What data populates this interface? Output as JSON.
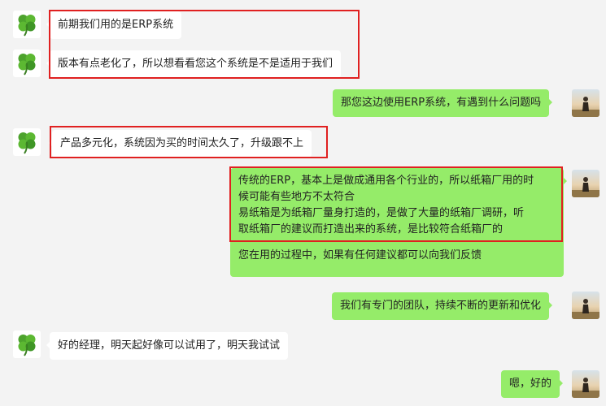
{
  "messages": {
    "m1": "前期我们用的是ERP系统",
    "m2": "版本有点老化了，所以想看看您这个系统是不是适用于我们",
    "m3": "那您这边使用ERP系统，有遇到什么问题吗",
    "m4": "产品多元化，系统因为买的时间太久了，升级跟不上",
    "m5": {
      "line1": "传统的ERP，基本上是做成通用各个行业的，所以纸箱厂用的时",
      "line2": "候可能有些地方不太符合",
      "line3": "易纸箱是为纸箱厂量身打造的，是做了大量的纸箱厂调研，听",
      "line4": "取纸箱厂的建议而打造出来的系统，是比较符合纸箱厂的",
      "line5": "您在用的过程中，如果有任何建议都可以向我们反馈"
    },
    "m6": "我们有专门的团队，持续不断的更新和优化",
    "m7": "好的经理，明天起好像可以试用了，明天我试试",
    "m8": "嗯，好的"
  },
  "colors": {
    "chat_background": "#f3f3f3",
    "incoming_bubble": "#ffffff",
    "outgoing_bubble": "#95ec69",
    "highlight_border": "#e02020"
  },
  "icons": {
    "contact_avatar": "four-leaf-clover-icon",
    "self_avatar": "person-portrait-icon"
  }
}
